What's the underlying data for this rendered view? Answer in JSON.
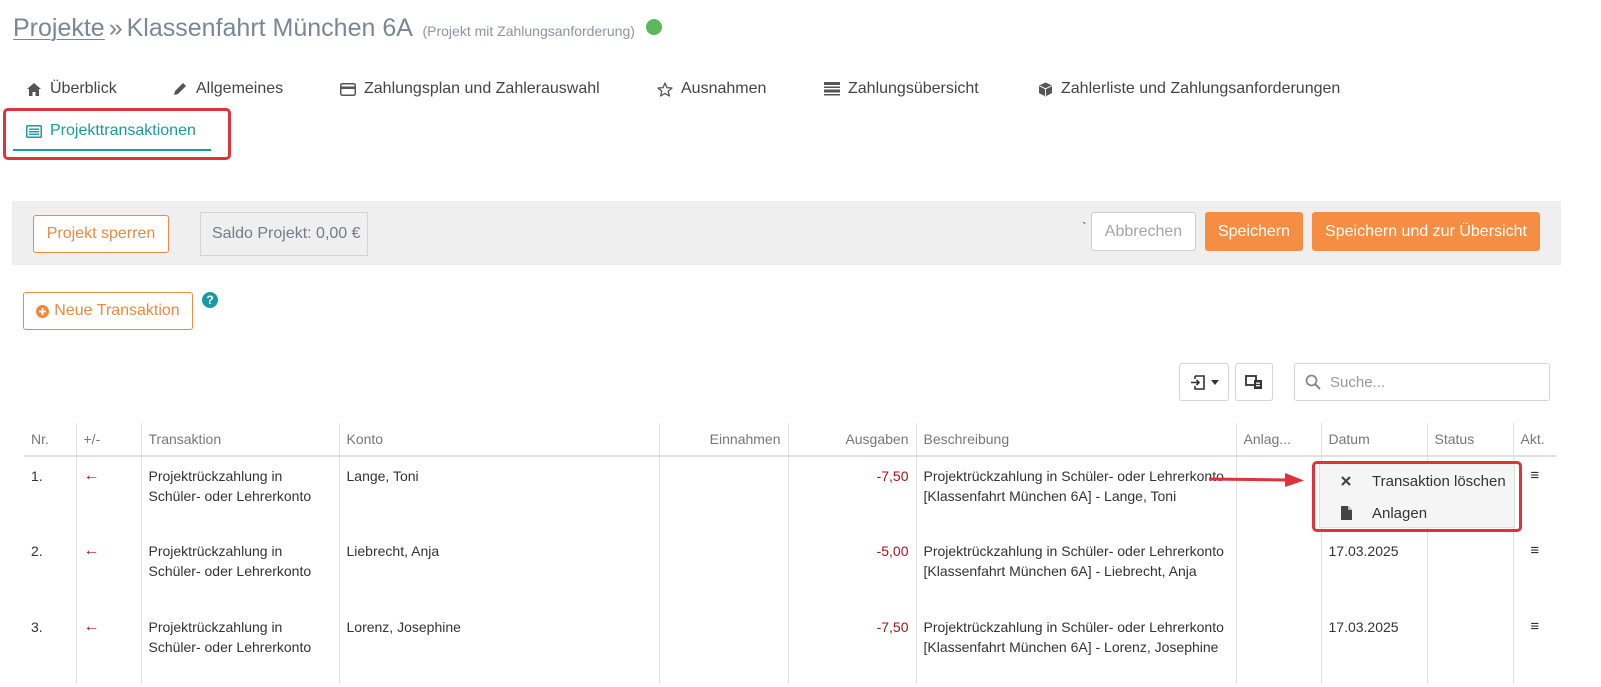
{
  "header": {
    "breadcrumb_link": "Projekte",
    "separator": "»",
    "project_name": "Klassenfahrt München 6A",
    "project_type": "(Projekt mit Zahlungsanforderung)",
    "status_color": "#5cb85c"
  },
  "tabs": [
    {
      "label": "Überblick",
      "icon": "home-icon"
    },
    {
      "label": "Allgemeines",
      "icon": "pencil-icon"
    },
    {
      "label": "Zahlungsplan und Zahlerauswahl",
      "icon": "credit-card-icon"
    },
    {
      "label": "Ausnahmen",
      "icon": "star-icon"
    },
    {
      "label": "Zahlungsübersicht",
      "icon": "list-icon"
    },
    {
      "label": "Zahlerliste und Zahlungsanforderungen",
      "icon": "cube-icon"
    },
    {
      "label": "Projekttransaktionen",
      "icon": "transactions-icon",
      "active": true
    }
  ],
  "toolbar": {
    "lock_label": "Projekt sperren",
    "saldo_label": "Saldo Projekt: 0,00 €",
    "backtick": "`",
    "cancel_label": "Abbrechen",
    "save_label": "Speichern",
    "save_overview_label": "Speichern und zur Übersicht"
  },
  "new_transaction_label": "Neue Transaktion",
  "help_label": "?",
  "search": {
    "placeholder": "Suche..."
  },
  "table": {
    "columns": [
      "Nr.",
      "+/-",
      "Transaktion",
      "Konto",
      "Einnahmen",
      "Ausgaben",
      "Beschreibung",
      "Anlag...",
      "Datum",
      "Status",
      "Akt."
    ],
    "rows": [
      {
        "nr": "1.",
        "sign": "←",
        "transaktion": "Projektrückzahlung in Schüler- oder Lehrerkonto",
        "konto": "Lange, Toni",
        "einnahmen": "",
        "ausgaben": "-7,50",
        "beschreibung": "Projektrückzahlung in Schüler- oder Lehrerkonto [Klassenfahrt München 6A] - Lange, Toni",
        "anlagen": "",
        "datum": "",
        "status": "",
        "akt": "≡"
      },
      {
        "nr": "2.",
        "sign": "←",
        "transaktion": "Projektrückzahlung in Schüler- oder Lehrerkonto",
        "konto": "Liebrecht, Anja",
        "einnahmen": "",
        "ausgaben": "-5,00",
        "beschreibung": "Projektrückzahlung in Schüler- oder Lehrerkonto [Klassenfahrt München 6A] - Liebrecht, Anja",
        "anlagen": "",
        "datum": "17.03.2025",
        "status": "",
        "akt": "≡"
      },
      {
        "nr": "3.",
        "sign": "←",
        "transaktion": "Projektrückzahlung in Schüler- oder Lehrerkonto",
        "konto": "Lorenz, Josephine",
        "einnahmen": "",
        "ausgaben": "-7,50",
        "beschreibung": "Projektrückzahlung in Schüler- oder Lehrerkonto [Klassenfahrt München 6A] - Lorenz, Josephine",
        "anlagen": "",
        "datum": "17.03.2025",
        "status": "",
        "akt": "≡"
      }
    ]
  },
  "context_menu": {
    "items": [
      {
        "label": "Transaktion löschen",
        "icon": "close-icon"
      },
      {
        "label": "Anlagen",
        "icon": "file-icon"
      }
    ]
  },
  "colors": {
    "accent": "#1a9aa0",
    "orange": "#f58d42",
    "highlight": "#e0323b",
    "negative": "#a8141a"
  }
}
